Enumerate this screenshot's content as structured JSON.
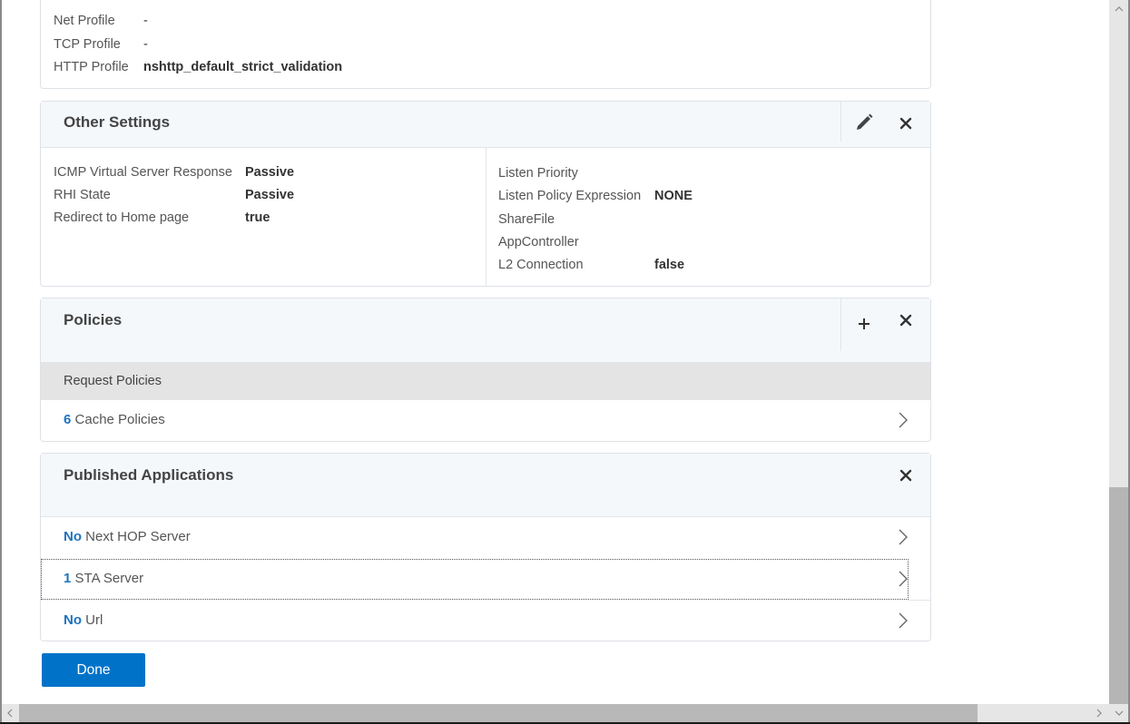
{
  "profiles_section": {
    "rows": [
      {
        "label": "Net Profile",
        "value": "-"
      },
      {
        "label": "TCP Profile",
        "value": "-"
      },
      {
        "label": "HTTP Profile",
        "value": "nshttp_default_strict_validation"
      }
    ]
  },
  "other_settings": {
    "title": "Other Settings",
    "left_rows": [
      {
        "label": "ICMP Virtual Server Response",
        "value": "Passive"
      },
      {
        "label": "RHI State",
        "value": "Passive"
      },
      {
        "label": "Redirect to Home page",
        "value": "true"
      }
    ],
    "right_rows": [
      {
        "label": "Listen Priority",
        "value": ""
      },
      {
        "label": "Listen Policy Expression",
        "value": "NONE"
      },
      {
        "label": "ShareFile",
        "value": ""
      },
      {
        "label": "AppController",
        "value": ""
      },
      {
        "label": "L2 Connection",
        "value": "false"
      }
    ],
    "icons": {
      "edit": "pencil-icon",
      "close": "close-icon"
    }
  },
  "policies": {
    "title": "Policies",
    "group_header": "Request Policies",
    "items": [
      {
        "count": "6",
        "label": "Cache Policies"
      }
    ],
    "icons": {
      "add": "plus-icon",
      "close": "close-icon"
    }
  },
  "published_applications": {
    "title": "Published Applications",
    "items": [
      {
        "count": "No",
        "label": "Next HOP Server"
      },
      {
        "count": "1",
        "label": "STA Server",
        "focused": true
      },
      {
        "count": "No",
        "label": "Url"
      }
    ],
    "icons": {
      "close": "close-icon"
    }
  },
  "actions": {
    "done_label": "Done",
    "accent_color": "#0073c9"
  },
  "colors": {
    "link_number": "#1e73be",
    "panel_header_bg": "#f5f8fb",
    "group_header_bg": "#e4e4e4"
  }
}
